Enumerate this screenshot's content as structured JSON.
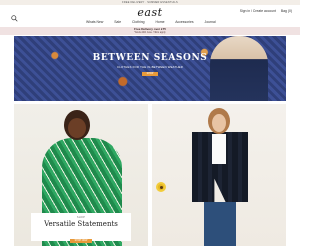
{
  "promo_strip": {
    "text": "FREE DELIVERY · SUMMER ESSENTIALS"
  },
  "header": {
    "logo_text": "east",
    "util_links": [
      "Sign in / Create account",
      "Bag (0)"
    ],
    "nav": [
      "Whats New",
      "Sale",
      "Clothing",
      "Home",
      "Accessories",
      "Journal"
    ]
  },
  "offer_banner": {
    "line1": "Free Delivery over £75",
    "line2": "*Ends 24th June. T&Cs apply"
  },
  "hero": {
    "title": "BETWEEN SEASONS",
    "subtitle": "CLOTHES FOR THE IN-BETWEEN WEATHER",
    "cta": "SHOP"
  },
  "card_left": {
    "eyebrow": "SHOP",
    "headline": "Versatile Statements",
    "cta": "SHOP NOW"
  },
  "colors": {
    "accent_orange": "#e89a3a",
    "banner_pink": "#f0e2e2",
    "dress_green": "#1f8a4c",
    "hero_blue": "#2a3666"
  }
}
